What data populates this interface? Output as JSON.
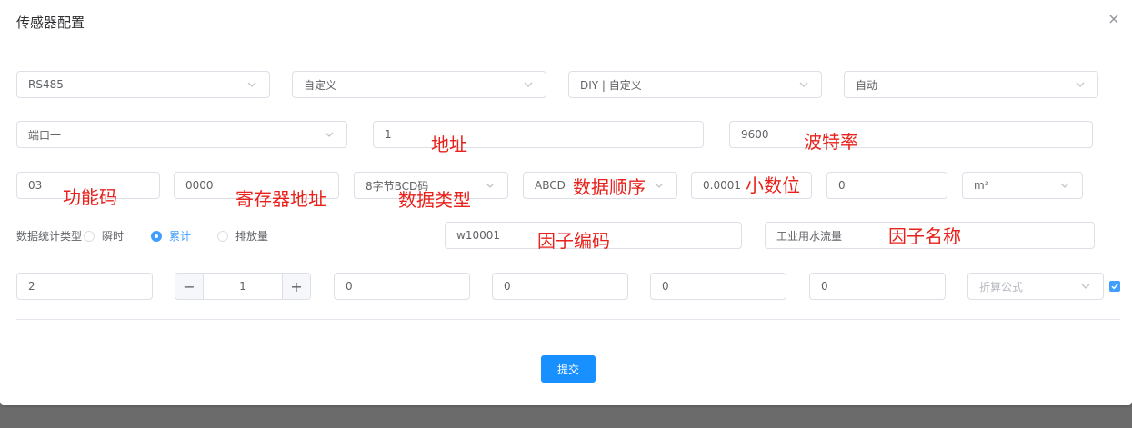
{
  "dialog": {
    "title": "传感器配置",
    "close_symbol": "×"
  },
  "row1": {
    "protocol": "RS485",
    "mode": "自定义",
    "device": "DIY | 自定义",
    "acquire": "自动"
  },
  "row2": {
    "port": "端口一",
    "address": "1",
    "baudrate": "9600"
  },
  "row3": {
    "function_code": "03",
    "register_address": "0000",
    "data_type": "8字节BCD码",
    "byte_order": "ABCD",
    "decimal": "0.0001",
    "offset": "0",
    "unit": "m³"
  },
  "row4": {
    "stat_label": "数据统计类型",
    "radios": [
      {
        "label": "瞬时",
        "checked": false
      },
      {
        "label": "累计",
        "checked": true
      },
      {
        "label": "排放量",
        "checked": false
      }
    ],
    "factor_code": "w10001",
    "factor_name": "工业用水流量"
  },
  "row5": {
    "value1": "2",
    "stepper_value": "1",
    "stepper_minus": "−",
    "stepper_plus": "+",
    "field1": "0",
    "field2": "0",
    "field3": "0",
    "field4": "0",
    "formula_placeholder": "折算公式",
    "checkbox_checked": true
  },
  "annotations": {
    "address": "地址",
    "baudrate": "波特率",
    "function_code": "功能码",
    "register_address": "寄存器地址",
    "data_type": "数据类型",
    "byte_order": "数据顺序",
    "decimal": "小数位",
    "factor_code": "因子编码",
    "factor_name": "因子名称"
  },
  "submit_label": "提交",
  "icons": {
    "dropdown": "chevron-down-icon",
    "close": "close-icon",
    "check": "check-icon"
  },
  "colors": {
    "primary": "#1890ff",
    "radio_active": "#409eff",
    "annotation": "#e8221b",
    "border": "#dcdfe6"
  }
}
